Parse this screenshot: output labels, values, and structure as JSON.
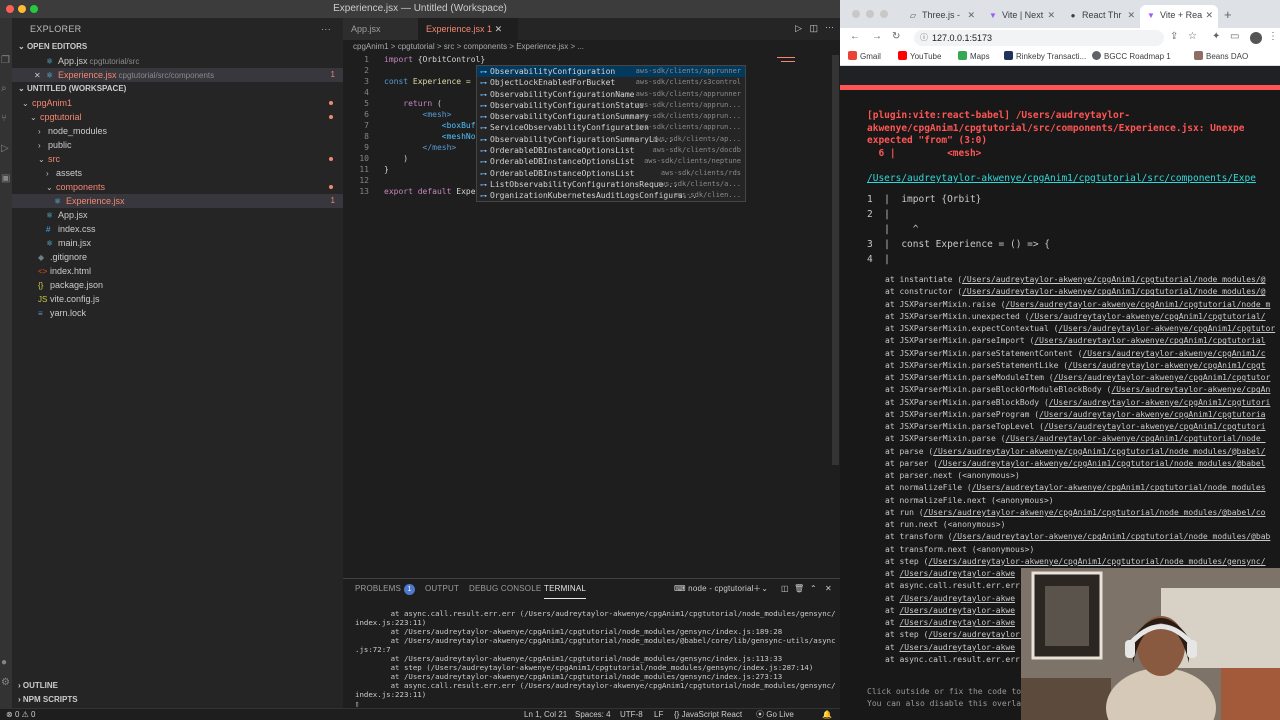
{
  "window_title": "Experience.jsx — Untitled (Workspace)",
  "sidebar": {
    "title": "EXPLORER",
    "open_editors_label": "OPEN EDITORS",
    "open_editors": [
      {
        "name": "App.jsx",
        "hint": "cpgtutorial/src"
      },
      {
        "name": "Experience.jsx",
        "hint": "cpgtutorial/src/components",
        "badge": "1"
      }
    ],
    "workspace_label": "UNTITLED (WORKSPACE)",
    "tree": [
      {
        "name": "cpgAnim1",
        "level": 0,
        "folder": true
      },
      {
        "name": "cpgtutorial",
        "level": 1,
        "folder": true
      },
      {
        "name": "node_modules",
        "level": 2,
        "folder": true
      },
      {
        "name": "public",
        "level": 2,
        "folder": true
      },
      {
        "name": "src",
        "level": 2,
        "folder": true
      },
      {
        "name": "assets",
        "level": 3,
        "folder": true
      },
      {
        "name": "components",
        "level": 3,
        "folder": true
      },
      {
        "name": "Experience.jsx",
        "level": 4,
        "badge": "1"
      },
      {
        "name": "App.jsx",
        "level": 3
      },
      {
        "name": "index.css",
        "level": 3
      },
      {
        "name": "main.jsx",
        "level": 3
      },
      {
        "name": ".gitignore",
        "level": 2
      },
      {
        "name": "index.html",
        "level": 2
      },
      {
        "name": "package.json",
        "level": 2
      },
      {
        "name": "vite.config.js",
        "level": 2
      },
      {
        "name": "yarn.lock",
        "level": 2
      }
    ],
    "outline_label": "OUTLINE",
    "npm_label": "NPM SCRIPTS"
  },
  "tabs": [
    {
      "label": "App.jsx",
      "active": false
    },
    {
      "label": "Experience.jsx 1",
      "active": true
    }
  ],
  "breadcrumb": "cpgAnim1  >  cpgtutorial  >  src  >  components  >  Experience.jsx  >  ...",
  "code": {
    "numbers": [
      "1",
      "2",
      "3",
      "4",
      "5",
      "6",
      "7",
      "8",
      "9",
      "10",
      "11",
      "12",
      "13"
    ],
    "l1_kw": "import",
    "l1_rest": " {OrbitControl}",
    "l3_kw": "const",
    "l3_rest": " Experience = (",
    "l5_kw": "return",
    "l5_rest": " (",
    "l6": "<mesh>",
    "l7": "<boxBuff",
    "l8": "<meshNor",
    "l9": "</mesh>",
    "l10": ")",
    "l11": "}",
    "l13_kw": "export default",
    "l13_rest": " Exper"
  },
  "suggestions": [
    {
      "label": "ObservabilityConfiguration",
      "detail": "aws-sdk/clients/apprunner"
    },
    {
      "label": "ObjectLockEnabledForBucket",
      "detail": "aws-sdk/clients/s3control"
    },
    {
      "label": "ObservabilityConfigurationName",
      "detail": "aws-sdk/clients/apprunner"
    },
    {
      "label": "ObservabilityConfigurationStatus",
      "detail": "aws-sdk/clients/apprun..."
    },
    {
      "label": "ObservabilityConfigurationSummary",
      "detail": "aws-sdk/clients/apprun..."
    },
    {
      "label": "ServiceObservabilityConfiguration",
      "detail": "aws-sdk/clients/apprun..."
    },
    {
      "label": "ObservabilityConfigurationSummaryLi...",
      "detail": "aws-sdk/clients/ap..."
    },
    {
      "label": "OrderableDBInstanceOptionsList",
      "detail": "aws-sdk/clients/docdb"
    },
    {
      "label": "OrderableDBInstanceOptionsList",
      "detail": "aws-sdk/clients/neptune"
    },
    {
      "label": "OrderableDBInstanceOptionsList",
      "detail": "aws-sdk/clients/rds"
    },
    {
      "label": "ListObservabilityConfigurationsReque...",
      "detail": "aws-sdk/clients/a..."
    },
    {
      "label": "OrganizationKubernetesAuditLogsConfigura...",
      "detail": "aws-sdk/clien..."
    }
  ],
  "panel": {
    "tabs": [
      "PROBLEMS",
      "OUTPUT",
      "DEBUG CONSOLE",
      "TERMINAL"
    ],
    "problems_count": "1",
    "terminal_name": "node - cpgtutorial",
    "lines": [
      "        at async.call.result.err.err (/Users/audreytaylor-akwenye/cpgAnim1/cpgtutorial/node_modules/gensync/",
      "index.js:223:11)",
      "        at /Users/audreytaylor-akwenye/cpgAnim1/cpgtutorial/node_modules/gensync/index.js:189:28",
      "        at /Users/audreytaylor-akwenye/cpgAnim1/cpgtutorial/node_modules/@babel/core/lib/gensync-utils/async",
      ".js:72:7",
      "        at /Users/audreytaylor-akwenye/cpgAnim1/cpgtutorial/node_modules/gensync/index.js:113:33",
      "        at step (/Users/audreytaylor-akwenye/cpgAnim1/cpgtutorial/node_modules/gensync/index.js:287:14)",
      "        at /Users/audreytaylor-akwenye/cpgAnim1/cpgtutorial/node_modules/gensync/index.js:273:13",
      "        at async.call.result.err.err (/Users/audreytaylor-akwenye/cpgAnim1/cpgtutorial/node_modules/gensync/",
      "index.js:223:11)"
    ]
  },
  "status": {
    "errors": "0",
    "warnings": "0",
    "position": "Ln 1, Col 21",
    "spaces": "Spaces: 4",
    "encoding": "UTF-8",
    "eol": "LF",
    "language": "JavaScript React",
    "golive": "Go Live"
  },
  "browser": {
    "tabs": [
      {
        "label": "Three.js -",
        "active": false
      },
      {
        "label": "Vite | Next",
        "active": false
      },
      {
        "label": "React Thr",
        "active": false
      },
      {
        "label": "Vite + Rea",
        "active": true
      }
    ],
    "url": "127.0.0.1:5173",
    "bookmarks": [
      "Gmail",
      "YouTube",
      "Maps",
      "Rinkeby Transacti...",
      "BGCC Roadmap 1",
      "Beans DAO"
    ],
    "error": {
      "head1": "[plugin:vite:react-babel] /Users/audreytaylor-",
      "head2": "akwenye/cpgAnim1/cpgtutorial/src/components/Experience.jsx: Unexpe",
      "head3": "expected \"from\" (3:0)",
      "head4": "  6 |         <mesh>",
      "file": "/Users/audreytaylor-akwenye/cpgAnim1/cpgtutorial/src/components/Expe",
      "frame": [
        "1  |  import {Orbit}",
        "2  |",
        "   |    ^",
        "3  |  const Experience = () => {",
        "4  |"
      ],
      "stack": [
        {
          "fn": "at instantiate (",
          "path": "/Users/audreytaylor-akwenye/cpgAnim1/cpgtutorial/node_modules/@"
        },
        {
          "fn": "at constructor (",
          "path": "/Users/audreytaylor-akwenye/cpgAnim1/cpgtutorial/node_modules/@"
        },
        {
          "fn": "at JSXParserMixin.raise (",
          "path": "/Users/audreytaylor-akwenye/cpgAnim1/cpgtutorial/node_m"
        },
        {
          "fn": "at JSXParserMixin.unexpected (",
          "path": "/Users/audreytaylor-akwenye/cpgAnim1/cpgtutorial/"
        },
        {
          "fn": "at JSXParserMixin.expectContextual (",
          "path": "/Users/audreytaylor-akwenye/cpgAnim1/cpgtutor"
        },
        {
          "fn": "at JSXParserMixin.parseImport (",
          "path": "/Users/audreytaylor-akwenye/cpgAnim1/cpgtutorial"
        },
        {
          "fn": "at JSXParserMixin.parseStatementContent (",
          "path": "/Users/audreytaylor-akwenye/cpgAnim1/c"
        },
        {
          "fn": "at JSXParserMixin.parseStatementLike (",
          "path": "/Users/audreytaylor-akwenye/cpgAnim1/cpgt"
        },
        {
          "fn": "at JSXParserMixin.parseModuleItem (",
          "path": "/Users/audreytaylor-akwenye/cpgAnim1/cpgtutor"
        },
        {
          "fn": "at JSXParserMixin.parseBlockOrModuleBlockBody (",
          "path": "/Users/audreytaylor-akwenye/cpgAn"
        },
        {
          "fn": "at JSXParserMixin.parseBlockBody (",
          "path": "/Users/audreytaylor-akwenye/cpgAnim1/cpgtutori"
        },
        {
          "fn": "at JSXParserMixin.parseProgram (",
          "path": "/Users/audreytaylor-akwenye/cpgAnim1/cpgtutoria"
        },
        {
          "fn": "at JSXParserMixin.parseTopLevel (",
          "path": "/Users/audreytaylor-akwenye/cpgAnim1/cpgtutori"
        },
        {
          "fn": "at JSXParserMixin.parse (",
          "path": "/Users/audreytaylor-akwenye/cpgAnim1/cpgtutorial/node_"
        },
        {
          "fn": "at parse (",
          "path": "/Users/audreytaylor-akwenye/cpgAnim1/cpgtutorial/node_modules/@babel/"
        },
        {
          "fn": "at parser (",
          "path": "/Users/audreytaylor-akwenye/cpgAnim1/cpgtutorial/node_modules/@babel"
        },
        {
          "fn": "at parser.next (<anonymous>)",
          "path": ""
        },
        {
          "fn": "at normalizeFile (",
          "path": "/Users/audreytaylor-akwenye/cpgAnim1/cpgtutorial/node_modules"
        },
        {
          "fn": "at normalizeFile.next (<anonymous>)",
          "path": ""
        },
        {
          "fn": "at run (",
          "path": "/Users/audreytaylor-akwenye/cpgAnim1/cpgtutorial/node_modules/@babel/co"
        },
        {
          "fn": "at run.next (<anonymous>)",
          "path": ""
        },
        {
          "fn": "at transform (",
          "path": "/Users/audreytaylor-akwenye/cpgAnim1/cpgtutorial/node_modules/@bab"
        },
        {
          "fn": "at transform.next (<anonymous>)",
          "path": ""
        },
        {
          "fn": "at step (",
          "path": "/Users/audreytaylor-akwenye/cpgAnim1/cpgtutorial/node_modules/gensync/"
        },
        {
          "fn": "at ",
          "path": "/Users/audreytaylor-akwe"
        },
        {
          "fn": "at async.call.result.err.err",
          "path": ""
        },
        {
          "fn": "at ",
          "path": "/Users/audreytaylor-akwe"
        },
        {
          "fn": "at ",
          "path": "/Users/audreytaylor-akwe"
        },
        {
          "fn": "at ",
          "path": "/Users/audreytaylor-akwe"
        },
        {
          "fn": "at step (",
          "path": "/Users/audreytaylor-akwe"
        },
        {
          "fn": "at ",
          "path": "/Users/audreytaylor-akwe"
        },
        {
          "fn": "at async.call.result.err.err",
          "path": ""
        }
      ],
      "tip1": "Click outside or fix the code to",
      "tip2": "You can also disable this overla"
    }
  },
  "colors": {
    "error_red": "#ff5555",
    "link_cyan": "#2dd9da",
    "vscode_bg": "#1e1e1e",
    "sidebar_bg": "#252526",
    "error_text": "#f48771"
  }
}
